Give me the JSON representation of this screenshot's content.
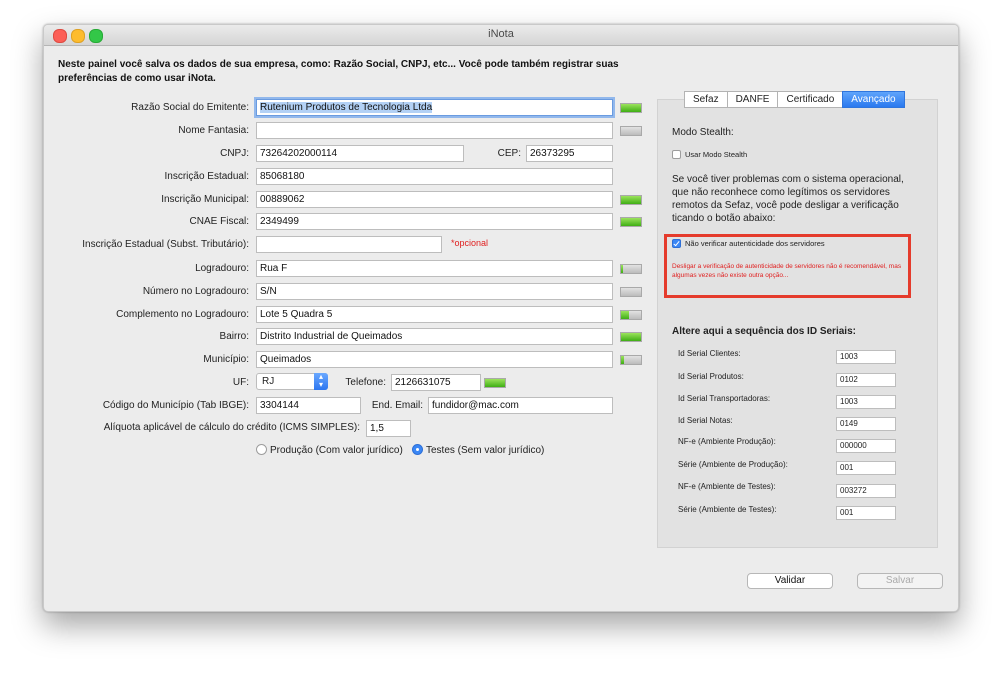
{
  "window": {
    "title": "iNota"
  },
  "intro": "Neste painel você salva os dados de sua empresa, como: Razão Social, CNPJ, etc... Você pode também registrar suas preferências de como usar iNota.",
  "form": {
    "razao_label": "Razão Social do Emitente:",
    "razao_value": "Rutenium Produtos de Tecnologia Ltda",
    "fantasia_label": "Nome Fantasia:",
    "fantasia_value": "",
    "cnpj_label": "CNPJ:",
    "cnpj_value": "73264202000114",
    "cep_label": "CEP:",
    "cep_value": "26373295",
    "ie_label": "Inscrição Estadual:",
    "ie_value": "85068180",
    "im_label": "Inscrição Municipal:",
    "im_value": "00889062",
    "cnae_label": "CNAE Fiscal:",
    "cnae_value": "2349499",
    "iest_label": "Inscrição Estadual (Subst. Tributário):",
    "iest_value": "",
    "optional_note": "*opcional",
    "logradouro_label": "Logradouro:",
    "logradouro_value": "Rua F",
    "numero_label": "Número no Logradouro:",
    "numero_value": "S/N",
    "complemento_label": "Complemento no Logradouro:",
    "complemento_value": "Lote 5 Quadra 5",
    "bairro_label": "Bairro:",
    "bairro_value": "Distrito Industrial de Queimados",
    "municipio_label": "Município:",
    "municipio_value": "Queimados",
    "uf_label": "UF:",
    "uf_value": "RJ",
    "telefone_label": "Telefone:",
    "telefone_value": "2126631075",
    "cod_municipio_label": "Código do Município (Tab IBGE):",
    "cod_municipio_value": "3304144",
    "email_label": "End. Email:",
    "email_value": "fundidor@mac.com",
    "aliquota_label": "Alíquota aplicável de cálculo do crédito (ICMS SIMPLES):",
    "aliquota_value": "1,5",
    "producao_label": "Produção (Com valor jurídico)",
    "testes_label": "Testes (Sem valor jurídico)",
    "environment_selected": "testes"
  },
  "meters": {
    "razao": 1.0,
    "fantasia": 0.0,
    "ie": 0.0,
    "im": 1.0,
    "cnae": 1.0,
    "logradouro": 0.1,
    "numero": 0.0,
    "complemento": 0.4,
    "bairro": 1.0,
    "municipio": 0.15,
    "telefone": 1.0
  },
  "tabs": [
    "Sefaz",
    "DANFE",
    "Certificado",
    "Avançado"
  ],
  "active_tab": "Avançado",
  "advanced": {
    "stealth_title": "Modo Stealth:",
    "stealth_checkbox": "Usar Modo Stealth",
    "stealth_checked": false,
    "description": "Se você tiver problemas com o sistema operacional, que não reconhece como legítimos os servidores remotos da Sefaz, você pode desligar a verificação ticando o botão abaixo:",
    "verify_checkbox": "Não verificar autenticidade dos servidores",
    "verify_checked": true,
    "warning": "Desligar a verificação de autenticidade de servidores não é recomendável, mas algumas vezes não existe outra opção...",
    "ids_title": "Altere aqui a sequência dos ID Seriais:",
    "ids": [
      {
        "label": "Id Serial Clientes:",
        "value": "1003"
      },
      {
        "label": "Id Serial Produtos:",
        "value": "0102"
      },
      {
        "label": "Id Serial Transportadoras:",
        "value": "1003"
      },
      {
        "label": "Id Serial Notas:",
        "value": "0149"
      },
      {
        "label": "NF-e (Ambiente Produção):",
        "value": "000000"
      },
      {
        "label": "Série (Ambiente de Produção):",
        "value": "001"
      },
      {
        "label": "NF-e (Ambiente de Testes):",
        "value": "003272"
      },
      {
        "label": "Série (Ambiente de Testes):",
        "value": "001"
      }
    ]
  },
  "buttons": {
    "validar": "Validar",
    "salvar": "Salvar"
  },
  "colors": {
    "accent": "#2a79ef",
    "warning": "#e02020",
    "highlight_border": "#e53b2c",
    "meter_green": "#3fae15"
  }
}
